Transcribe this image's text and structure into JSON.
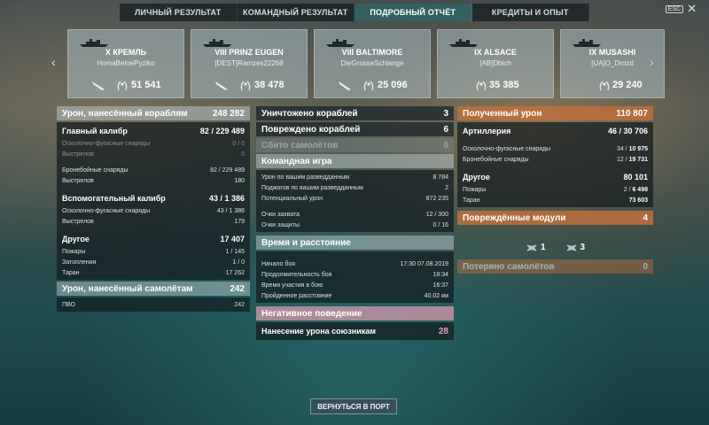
{
  "tabs": [
    {
      "label": "ЛИЧНЫЙ РЕЗУЛЬТАТ",
      "active": false
    },
    {
      "label": "КОМАНДНЫЙ РЕЗУЛЬТАТ",
      "active": false
    },
    {
      "label": "ПОДРОБНЫЙ ОТЧЁТ",
      "active": true
    },
    {
      "label": "КРЕДИТЫ И ОПЫТ",
      "active": false
    }
  ],
  "esc": {
    "key": "ESC",
    "icon": "close-icon"
  },
  "ships": [
    {
      "name": "X КРЕМЛЬ",
      "player": "HomaBeloePyziko",
      "score": "51 541"
    },
    {
      "name": "VIII PRINZ EUGEN",
      "player": "[DEST]Ramzes22268",
      "score": "38 478"
    },
    {
      "name": "VIII BALTIMORE",
      "player": "DieGrosseSchlange",
      "score": "25 096"
    },
    {
      "name": "IX ALSACE",
      "player": "[AB]Dbich",
      "score": "35 385"
    },
    {
      "name": "IX MUSASHI",
      "player": "[UA]O_Drozd",
      "score": "29 240"
    }
  ],
  "col1": {
    "dmg_header": {
      "label": "Урон, нанесённый кораблям",
      "value": "248 282"
    },
    "main": {
      "label": "Главный калибр",
      "value_a": "82",
      "value_b": "229 489"
    },
    "main_rows": [
      {
        "label": "Осколочно-фугасные снаряды",
        "value": "0 / 0",
        "dim": true
      },
      {
        "label": "Выстрелов",
        "value": "0",
        "dim": true
      },
      {
        "label": "Бронебойные снаряды",
        "value": "82 / 229 489",
        "dim": false
      },
      {
        "label": "Выстрелов",
        "value": "180",
        "dim": false
      }
    ],
    "secondary": {
      "label": "Вспомогательный калибр",
      "value": "43 / 1 386"
    },
    "secondary_rows": [
      {
        "label": "Осколочно-фугасные снаряды",
        "value": "43 / 1 386"
      },
      {
        "label": "Выстрелов",
        "value": "179"
      }
    ],
    "other": {
      "label": "Другое",
      "value": "17 407"
    },
    "other_rows": [
      {
        "label": "Пожары",
        "value": "1 / 145"
      },
      {
        "label": "Затопления",
        "value": "1 / 0"
      },
      {
        "label": "Таран",
        "value": "17 262"
      }
    ],
    "planes_header": {
      "label": "Урон, нанесённый самолётам",
      "value": "242"
    },
    "planes_rows": [
      {
        "label": "ПВО",
        "value": "242"
      }
    ]
  },
  "col2": {
    "destroyed": {
      "label": "Уничтожено кораблей",
      "value": "3"
    },
    "damaged": {
      "label": "Повреждено кораблей",
      "value": "6"
    },
    "planes_down": {
      "label": "Сбито самолётов",
      "value": "0"
    },
    "team_header": "Командная игра",
    "team_rows": [
      {
        "label": "Урон по вашим разведданным",
        "value": "8 784"
      },
      {
        "label": "Поджогов по вашим разведданным",
        "value": "2"
      },
      {
        "label": "Потенциальный урон",
        "value": "872 235"
      },
      {
        "label": "Очки захвата",
        "value": "12 / 300"
      },
      {
        "label": "Очки защиты",
        "value": "0 / 16"
      }
    ],
    "time_header": "Время и расстояние",
    "time_rows": [
      {
        "label": "Начало боя",
        "value": "17:30  07.08.2019"
      },
      {
        "label": "Продолжительность боя",
        "value": "18:34"
      },
      {
        "label": "Время участия в бою",
        "value": "16:37"
      },
      {
        "label": "Пройденное расстояние",
        "value": "40.02 км"
      }
    ],
    "negative_header": "Негативное поведение",
    "negative": {
      "label": "Нанесение урона союзникам",
      "value": "28"
    }
  },
  "col3": {
    "received_header": {
      "label": "Полученный урон",
      "value": "110 807"
    },
    "artillery": {
      "label": "Артиллерия",
      "value_a": "46",
      "value_b": "30 706"
    },
    "art_rows": [
      {
        "label": "Осколочно-фугасные снаряды",
        "value_a": "34",
        "value_b": "10 975"
      },
      {
        "label": "Бронебойные снаряды",
        "value_a": "12",
        "value_b": "19 731"
      }
    ],
    "other": {
      "label": "Другое",
      "value": "80 101"
    },
    "other_rows": [
      {
        "label": "Пожары",
        "value_a": "2",
        "value_b": "6 498"
      },
      {
        "label": "Таран",
        "value": "73 603"
      }
    ],
    "modules_header": {
      "label": "Повреждённые модули",
      "value": "4"
    },
    "modules": [
      {
        "icon": "module-icon",
        "count": "1"
      },
      {
        "icon": "module-icon",
        "count": "3"
      }
    ],
    "planes_lost": {
      "label": "Потеряно самолётов",
      "value": "0"
    }
  },
  "port_button": "ВЕРНУТЬСЯ В ПОРТ",
  "colors": {
    "accent_teal": "#468c8c",
    "received_orange": "#be6e3c",
    "negative_pink": "#cd96aa"
  }
}
